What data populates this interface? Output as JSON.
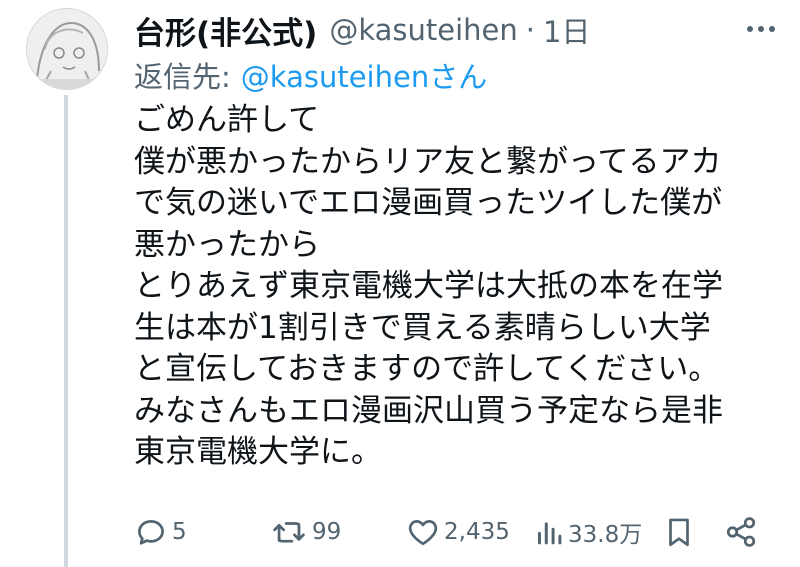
{
  "tweet": {
    "author": {
      "display_name": "台形(非公式)",
      "handle": "@kasuteihen",
      "time_ago": "1日"
    },
    "reply_to": {
      "label": "返信先:",
      "mention": "@kasuteihenさん"
    },
    "body_lines": [
      "ごめん許して",
      "僕が悪かったからリア友と繋がってるアカ",
      "で気の迷いでエロ漫画買ったツイした僕が",
      "悪かったから",
      "とりあえず東京電機大学は大抵の本を在学",
      "生は本が1割引きで買える素晴らしい大学",
      "と宣伝しておきますので許してください。",
      "みなさんもエロ漫画沢山買う予定なら是非",
      "東京電機大学に。"
    ],
    "actions": {
      "reply_count": "5",
      "retweet_count": "99",
      "like_count": "2,435",
      "view_count": "33.8万"
    },
    "icons": {
      "avatar": "avatar-illustration",
      "more": "more-options-icon",
      "reply": "reply-bubble-icon",
      "retweet": "retweet-icon",
      "like": "heart-icon",
      "views": "views-bar-chart-icon",
      "bookmark": "bookmark-icon",
      "share": "share-icon"
    },
    "colors": {
      "text": "#0f1419",
      "secondary": "#536471",
      "link": "#1d9bf0",
      "thread_line": "#cfd9de"
    }
  }
}
